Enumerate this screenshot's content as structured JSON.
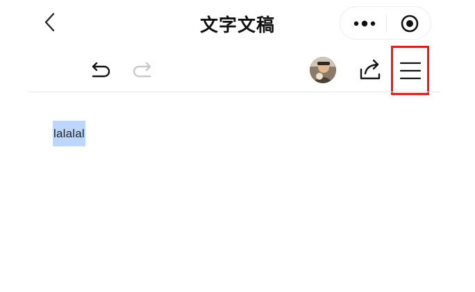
{
  "header": {
    "title": "文字文稿",
    "back_icon": "chevron-left-icon",
    "more_icon": "more-dots-icon",
    "target_icon": "target-icon"
  },
  "toolbar": {
    "undo_icon": "undo-icon",
    "redo_icon": "redo-icon",
    "avatar": "user-avatar",
    "share_icon": "share-icon",
    "menu_icon": "hamburger-menu-icon",
    "highlight_color": "#e31c1c"
  },
  "document": {
    "text": "lalalal",
    "selection_color": "#bcd7fb"
  }
}
